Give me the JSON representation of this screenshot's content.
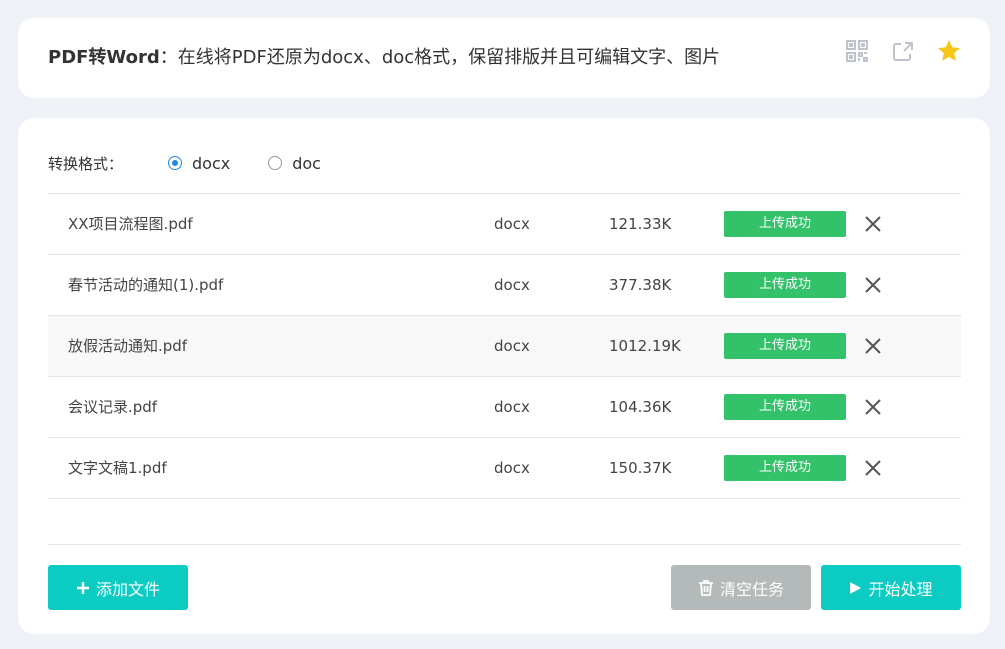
{
  "header": {
    "title_strong": "PDF转Word",
    "title_sep": "：",
    "title_desc": "在线将PDF还原为docx、doc格式，保留排版并且可编辑文字、图片",
    "icons": [
      "qrcode-icon",
      "share-icon",
      "star-icon"
    ],
    "star_color": "#f5c518",
    "icon_color": "#bfc4cc"
  },
  "format": {
    "label": "转换格式：",
    "options": [
      {
        "label": "docx",
        "checked": true
      },
      {
        "label": "doc",
        "checked": false
      }
    ]
  },
  "files": [
    {
      "name": "XX项目流程图.pdf",
      "format": "docx",
      "size": "121.33K",
      "status": "上传成功"
    },
    {
      "name": "春节活动的通知(1).pdf",
      "format": "docx",
      "size": "377.38K",
      "status": "上传成功"
    },
    {
      "name": "放假活动通知.pdf",
      "format": "docx",
      "size": "1012.19K",
      "status": "上传成功"
    },
    {
      "name": "会议记录.pdf",
      "format": "docx",
      "size": "104.36K",
      "status": "上传成功"
    },
    {
      "name": "文字文稿1.pdf",
      "format": "docx",
      "size": "150.37K",
      "status": "上传成功"
    }
  ],
  "actions": {
    "add_label": "添加文件",
    "clear_label": "清空任务",
    "start_label": "开始处理"
  },
  "colors": {
    "accent": "#0ccbc2",
    "success": "#33c26a",
    "disabled": "#b4bab9",
    "radio_active": "#1e88e5"
  }
}
